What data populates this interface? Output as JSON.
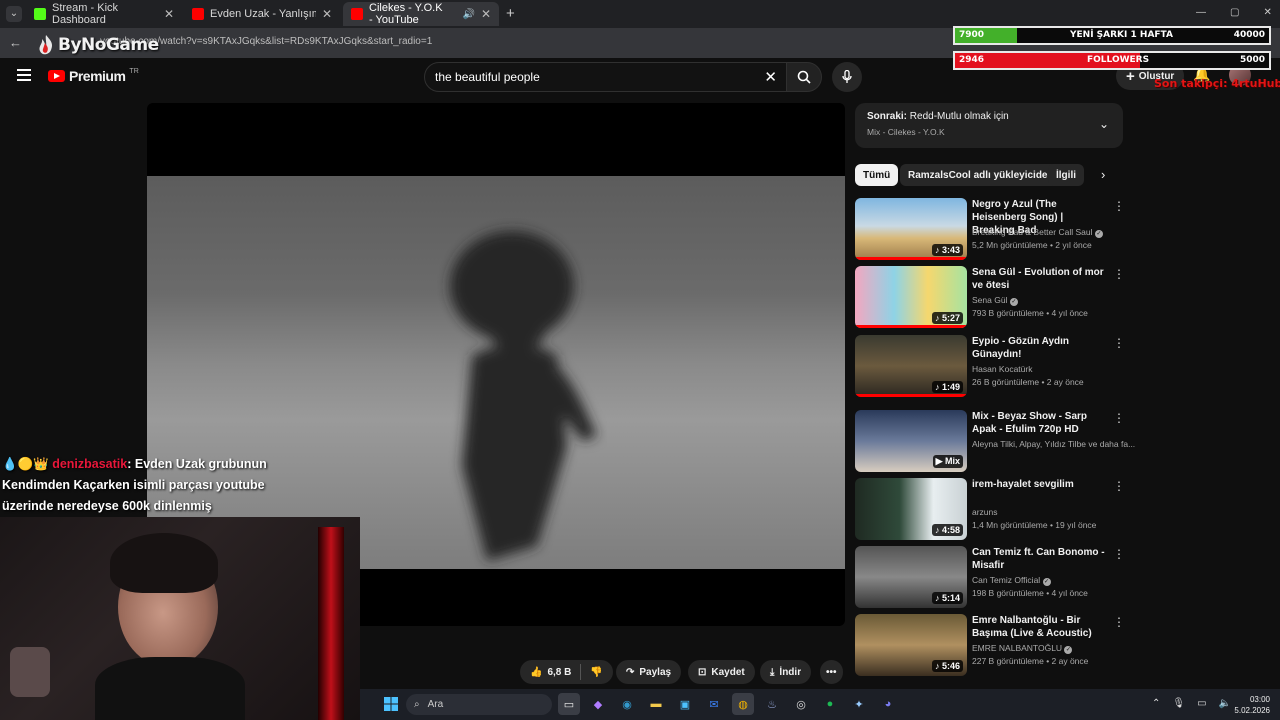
{
  "browser": {
    "tabs": [
      {
        "title": "Stream - Kick Dashboard",
        "fav_color": "#53fc18"
      },
      {
        "title": "Evden Uzak - Yanlışım Olma - Y",
        "fav_color": "#ff0000"
      },
      {
        "title": "Cilekes - Y.O.K - YouTube",
        "fav_color": "#ff0000"
      }
    ],
    "url": "youtube.com/watch?v=s9KTAxJGqks&list=RDs9KTAxJGqks&start_radio=1",
    "new_tab": "+",
    "window_controls": [
      "—",
      "▢",
      "✕"
    ]
  },
  "watermark": "ByNoGame",
  "youtube": {
    "logo": "Premium",
    "logo_country": "TR",
    "search_query": "the beautiful people",
    "create_label": "Oluştur"
  },
  "up_next": {
    "label": "Sonraki:",
    "title": "Redd-Mutlu olmak için",
    "subtitle": "Mix - Cilekes - Y.O.K"
  },
  "chips": [
    "Tümü",
    "RamzalsCool adlı yükleyiciden",
    "İlgili"
  ],
  "recommendations": [
    {
      "title": "Negro y Azul (The Heisenberg Song) | Breaking Bad",
      "channel": "Breaking Bad & Better Call Saul",
      "verified": true,
      "meta": "5,2 Mn görüntüleme • 2 yıl önce",
      "duration": "3:43",
      "progress": 1.0
    },
    {
      "title": "Sena Gül - Evolution of mor ve ötesi",
      "channel": "Sena Gül",
      "verified": true,
      "meta": "793 B görüntüleme • 4 yıl önce",
      "duration": "5:27",
      "progress": 1.0
    },
    {
      "title": "Eypio - Gözün Aydın Günaydın!",
      "channel": "Hasan Kocatürk",
      "verified": false,
      "meta": "26 B görüntüleme • 2 ay önce",
      "duration": "1:49",
      "progress": 1.0
    },
    {
      "title": "Mix - Beyaz Show - Sarp Apak - Efulim 720p HD",
      "channel": "Aleyna Tilki, Alpay, Yıldız Tilbe ve daha fa...",
      "verified": false,
      "meta": "",
      "duration": "Mix",
      "progress": 0
    },
    {
      "title": "irem-hayalet sevgilim",
      "channel": "arzuns",
      "verified": false,
      "meta": "1,4 Mn görüntüleme • 19 yıl önce",
      "duration": "4:58",
      "progress": 0
    },
    {
      "title": "Can Temiz ft. Can Bonomo - Misafir",
      "channel": "Can Temiz Official",
      "verified": true,
      "meta": "198 B görüntüleme • 4 yıl önce",
      "duration": "5:14",
      "progress": 0
    },
    {
      "title": "Emre Nalbantoğlu - Bir Başıma (Live & Acoustic)",
      "channel": "EMRE NALBANTOĞLU",
      "verified": true,
      "meta": "227 B görüntüleme • 2 ay önce",
      "duration": "5:46",
      "progress": 0
    }
  ],
  "actions": {
    "likes": "6,8 B",
    "share": "Paylaş",
    "save": "Kaydet",
    "download": "İndir"
  },
  "overlay": {
    "goal1": {
      "current": "7900",
      "label": "YENİ ŞARKI 1 HAFTA",
      "target": "40000",
      "progress": 0.1975,
      "color": "#43b02a"
    },
    "goal2": {
      "current": "2946",
      "label": "FOLLOWERS",
      "target": "5000",
      "progress": 0.589,
      "color": "#e3101e"
    },
    "top_text": "Son takipçi: 4rtuHub",
    "chat_user": "denizbasatik",
    "chat_message": ": Evden Uzak grubunun Kendimden Kaçarken isimli parçası youtube üzerinde neredeyse 600k dinlenmiş"
  },
  "taskbar": {
    "search_placeholder": "Ara",
    "time": "03:00",
    "date": "5.02.2026"
  }
}
